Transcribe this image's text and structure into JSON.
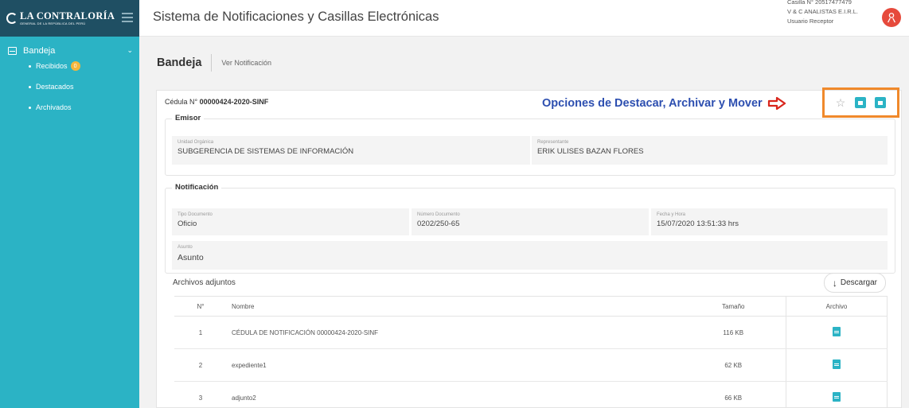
{
  "brand": {
    "title": "LA CONTRALORÍA",
    "subtitle": "GENERAL DE LA REPÚBLICA DEL PERÚ"
  },
  "sidebar": {
    "section_label": "Bandeja",
    "items": [
      {
        "label": "Recibidos",
        "badge": "0"
      },
      {
        "label": "Destacados"
      },
      {
        "label": "Archivados"
      }
    ]
  },
  "header": {
    "title": "Sistema de Notificaciones y Casillas Electrónicas",
    "user_line1": "Casilla N° 20517477479",
    "user_line2": "V & C ANALISTAS E.I.R.L.",
    "user_line3": "Usuario Receptor"
  },
  "breadcrumb": {
    "title": "Bandeja",
    "sub": "Ver Notificación"
  },
  "card": {
    "cedula_prefix": "Cédula N°",
    "cedula_number": "00000424-2020-SINF",
    "annotation": "Opciones de Destacar, Archivar y Mover"
  },
  "emisor": {
    "legend": "Emisor",
    "unidad_label": "Unidad Orgánica",
    "unidad_value": "SUBGERENCIA DE SISTEMAS DE INFORMACIÓN",
    "rep_label": "Representante",
    "rep_value": "ERIK ULISES BAZAN FLORES"
  },
  "notificacion": {
    "legend": "Notificación",
    "tipo_label": "Tipo Documento",
    "tipo_value": "Oficio",
    "num_label": "Número Documento",
    "num_value": "0202/250-65",
    "fecha_label": "Fecha y Hora",
    "fecha_value": "15/07/2020 13:51:33 hrs",
    "asunto_label": "Asunto",
    "asunto_value": "Asunto"
  },
  "attachments": {
    "title": "Archivos adjuntos",
    "download_label": "Descargar",
    "headers": [
      "N°",
      "Nombre",
      "Tamaño",
      "Archivo"
    ],
    "rows": [
      {
        "n": "1",
        "name": "CÉDULA DE NOTIFICACIÓN 00000424-2020-SINF",
        "size": "116 KB"
      },
      {
        "n": "2",
        "name": "expediente1",
        "size": "62 KB"
      },
      {
        "n": "3",
        "name": "adjunto2",
        "size": "66 KB"
      }
    ]
  },
  "colors": {
    "sidebar": "#2bb3c5",
    "logo_bar": "#1f4f63",
    "annotation": "#2d4fb0",
    "highlight_box": "#f0892b",
    "avatar": "#e64a3c"
  }
}
